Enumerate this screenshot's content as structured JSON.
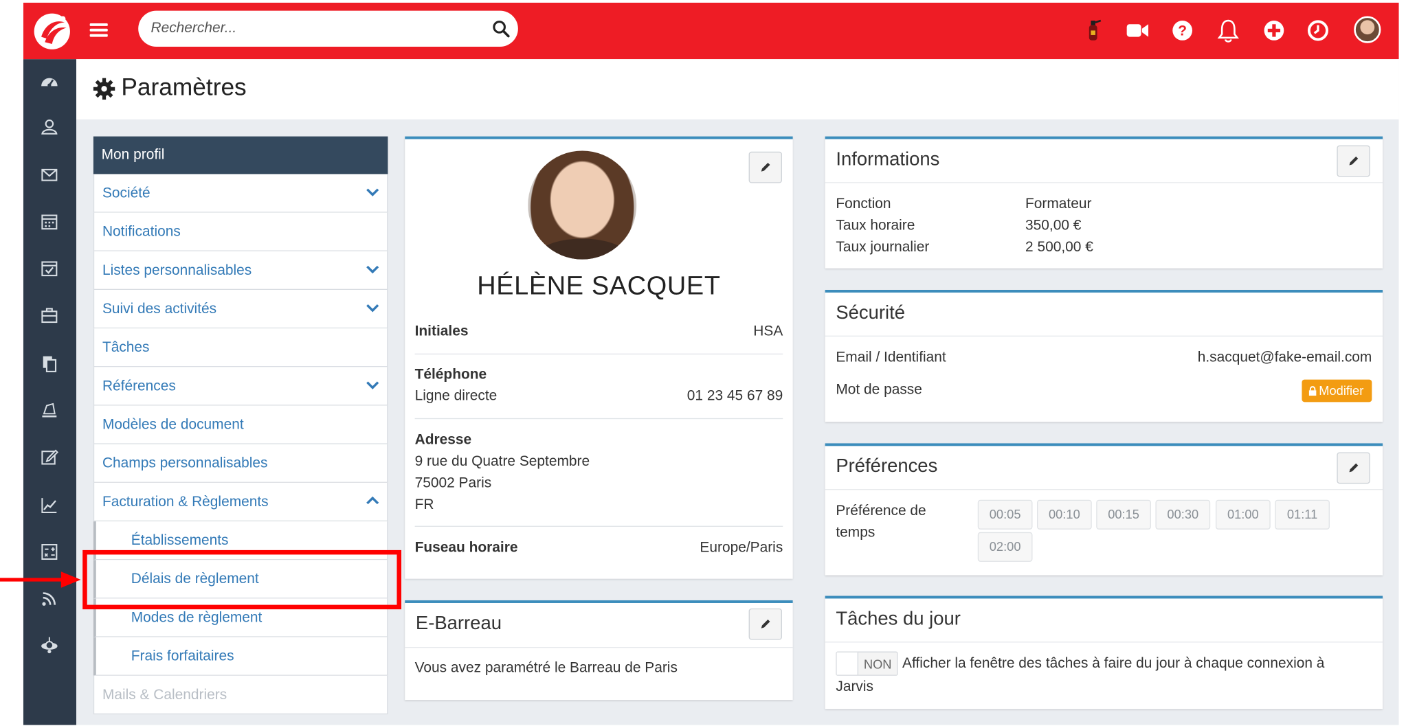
{
  "topbar": {
    "search_placeholder": "Rechercher...",
    "icons": [
      "logo-icon",
      "hamburger-icon",
      "search-icon",
      "fire-extinguisher-icon",
      "video-icon",
      "help-icon",
      "bell-icon",
      "plus-circle-icon",
      "clock-icon",
      "avatar"
    ],
    "color": "#ee1c25"
  },
  "sidebar": {
    "icons": [
      "dashboard-icon",
      "contacts-icon",
      "mail-icon",
      "calendar-icon",
      "tasks-icon",
      "briefcase-icon",
      "documents-icon",
      "invoice-icon",
      "edit-icon",
      "chart-icon",
      "calculator-icon",
      "rss-icon",
      "robot-icon"
    ],
    "color": "#2d3a4a"
  },
  "page": {
    "title": "Paramètres"
  },
  "menu": {
    "header": "Mon profil",
    "items": [
      {
        "label": "Société"
      },
      {
        "label": "Notifications"
      },
      {
        "label": "Listes personnalisables"
      },
      {
        "label": "Suivi des activités"
      },
      {
        "label": "Tâches"
      },
      {
        "label": "Références"
      },
      {
        "label": "Modèles de document"
      },
      {
        "label": "Champs personnalisables"
      },
      {
        "label": "Facturation & Règlements"
      },
      {
        "label": "Établissements"
      },
      {
        "label": "Délais de règlement"
      },
      {
        "label": "Modes de règlement"
      },
      {
        "label": "Frais forfaitaires"
      },
      {
        "label": "Mails & Calendriers"
      }
    ]
  },
  "profile": {
    "name": "HÉLÈNE SACQUET",
    "initiales_label": "Initiales",
    "initiales": "HSA",
    "telephone_label": "Téléphone",
    "ligne_directe_label": "Ligne directe",
    "ligne_directe": "01 23 45 67 89",
    "adresse_label": "Adresse",
    "adresse_lines": [
      "9 rue du Quatre Septembre",
      "75002 Paris",
      "FR"
    ],
    "fuseau_label": "Fuseau horaire",
    "fuseau": "Europe/Paris"
  },
  "ebarreau": {
    "title": "E-Barreau",
    "text": "Vous avez paramétré le Barreau de Paris"
  },
  "informations": {
    "title": "Informations",
    "rows": [
      {
        "label": "Fonction",
        "value": "Formateur"
      },
      {
        "label": "Taux horaire",
        "value": "350,00 €"
      },
      {
        "label": "Taux journalier",
        "value": "2 500,00 €"
      }
    ]
  },
  "securite": {
    "title": "Sécurité",
    "email_label": "Email / Identifiant",
    "email": "h.sacquet@fake-email.com",
    "password_label": "Mot de passe",
    "modify_button": "Modifier",
    "modify_color": "#f39c12"
  },
  "preferences": {
    "title": "Préférences",
    "label_line1": "Préférence de",
    "label_line2": "temps",
    "times": [
      "00:05",
      "00:10",
      "00:15",
      "00:30",
      "01:00",
      "01:11",
      "02:00"
    ]
  },
  "taches": {
    "title": "Tâches du jour",
    "toggle": "NON",
    "text_line1": "Afficher la fenêtre des tâches à faire du jour à chaque connexion à",
    "text_line2": "Jarvis"
  },
  "colors": {
    "accent": "#3c8dbc",
    "link": "#337ab7",
    "highlight": "#ff0000"
  }
}
